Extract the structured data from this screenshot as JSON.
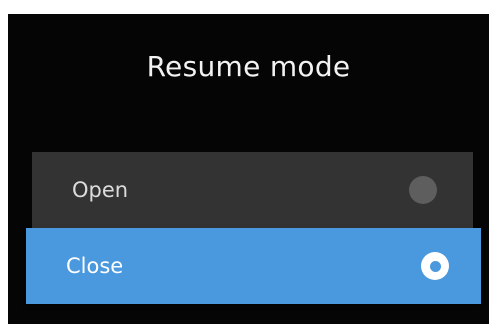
{
  "dialog": {
    "title": "Resume mode",
    "options": [
      {
        "label": "Open",
        "selected": false
      },
      {
        "label": "Close",
        "selected": true
      }
    ]
  },
  "colors": {
    "background": "#050505",
    "unselected_option": "#333333",
    "selected_option": "#4a98dd",
    "radio_unselected": "#5e5e5e",
    "radio_selected": "#ffffff"
  }
}
